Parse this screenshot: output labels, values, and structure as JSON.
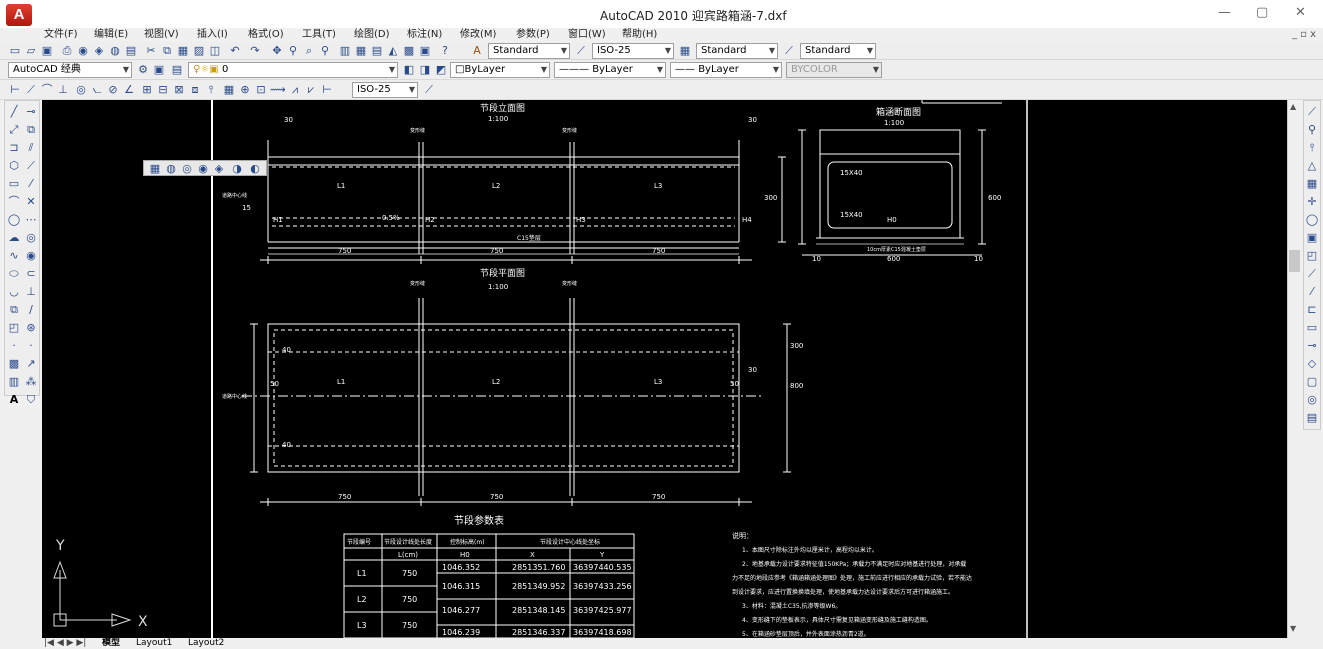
{
  "app": {
    "logo": "A",
    "title": "AutoCAD 2010    迎宾路箱涵-7.dxf"
  },
  "window": {
    "minimize": "—",
    "maximize": "▢",
    "close": "✕",
    "doc_controls": "_ ▫ x"
  },
  "menu": [
    "文件(F)",
    "编辑(E)",
    "视图(V)",
    "插入(I)",
    "格式(O)",
    "工具(T)",
    "绘图(D)",
    "标注(N)",
    "修改(M)",
    "参数(P)",
    "窗口(W)",
    "帮助(H)"
  ],
  "toolbar1": {
    "text_style": "Standard",
    "dim_style": "ISO-25",
    "table_style": "Standard",
    "multileader_style": "Standard"
  },
  "toolbar2": {
    "workspace": "AutoCAD 经典",
    "layer": "0",
    "color": "ByLayer",
    "linetype": "ByLayer",
    "lineweight": "ByLayer",
    "plotstyle": "BYCOLOR"
  },
  "toolbar3": {
    "dim_style": "ISO-25"
  },
  "drawing": {
    "elevation_title": "节段立面图",
    "elevation_scale": "1:100",
    "plan_title": "节段平面图",
    "plan_scale": "1:100",
    "section_title": "箱涵断面图",
    "section_scale": "1:100",
    "params_title": "节段参数表",
    "label_joint": "变形缝",
    "label_road": "道路中心线",
    "label_cushion": "C15垫层",
    "label_slope": "0.5%",
    "label_15x40": "15X40",
    "label_bottom": "10cm厚素C15混凝土垫层",
    "segments": [
      "L1",
      "L2",
      "L3"
    ],
    "heights": [
      "H1",
      "H2",
      "H3",
      "H4"
    ],
    "dims_750": "750",
    "dim_30": "30",
    "dim_50": "50",
    "dim_40": "40",
    "dim_300": "300",
    "dim_600": "600",
    "dim_800": "800",
    "dim_10": "10",
    "dim_15": "15",
    "dim_H0": "H0",
    "ucs_x": "X",
    "ucs_y": "Y",
    "notes_title": "说明：",
    "notes": [
      "1、本图尺寸除标注外均以厘米计，高程均以米计。",
      "2、地基承载力设计要求特征值150KPa；承载力不满足时应对地基进行处理，对承载",
      "力不足的地段应参考《箱涵箱涵处理图》处理，施工前应进行相应的承载力试验，若不能达",
      "到设计要求，应进行置换换填处理，使地基承载力达设计要求后方可进行箱涵施工。",
      "3、材料：混凝土C35,抗渗等级W6。",
      "4、变形缝下的垫板表示，具体尺寸需复见箱涵变形缝及施工缝构造图。",
      "5、在箱涵砂垫层顶后，并外表面涂热沥青2道。"
    ],
    "table": {
      "headers": [
        "节段编号",
        "节段设计线处长度",
        "控制标高(m)",
        "节段设计中心线处坐标"
      ],
      "subheaders": [
        "L(cm)",
        "H0",
        "X",
        "Y"
      ],
      "rows": [
        {
          "seg": "L1",
          "len": "750"
        },
        {
          "seg": "L2",
          "len": "750"
        },
        {
          "seg": "L3",
          "len": "750"
        }
      ],
      "points": [
        {
          "h": "1046.352",
          "x": "2851351.760",
          "y": "36397440.535"
        },
        {
          "h": "1046.315",
          "x": "2851349.952",
          "y": "36397433.256"
        },
        {
          "h": "1046.277",
          "x": "2851348.145",
          "y": "36397425.977"
        },
        {
          "h": "1046.239",
          "x": "2851346.337",
          "y": "36397418.698"
        }
      ]
    }
  },
  "tabs": {
    "nav": "|◀ ◀ ▶ ▶|",
    "model": "模型",
    "layout1": "Layout1",
    "layout2": "Layout2"
  }
}
